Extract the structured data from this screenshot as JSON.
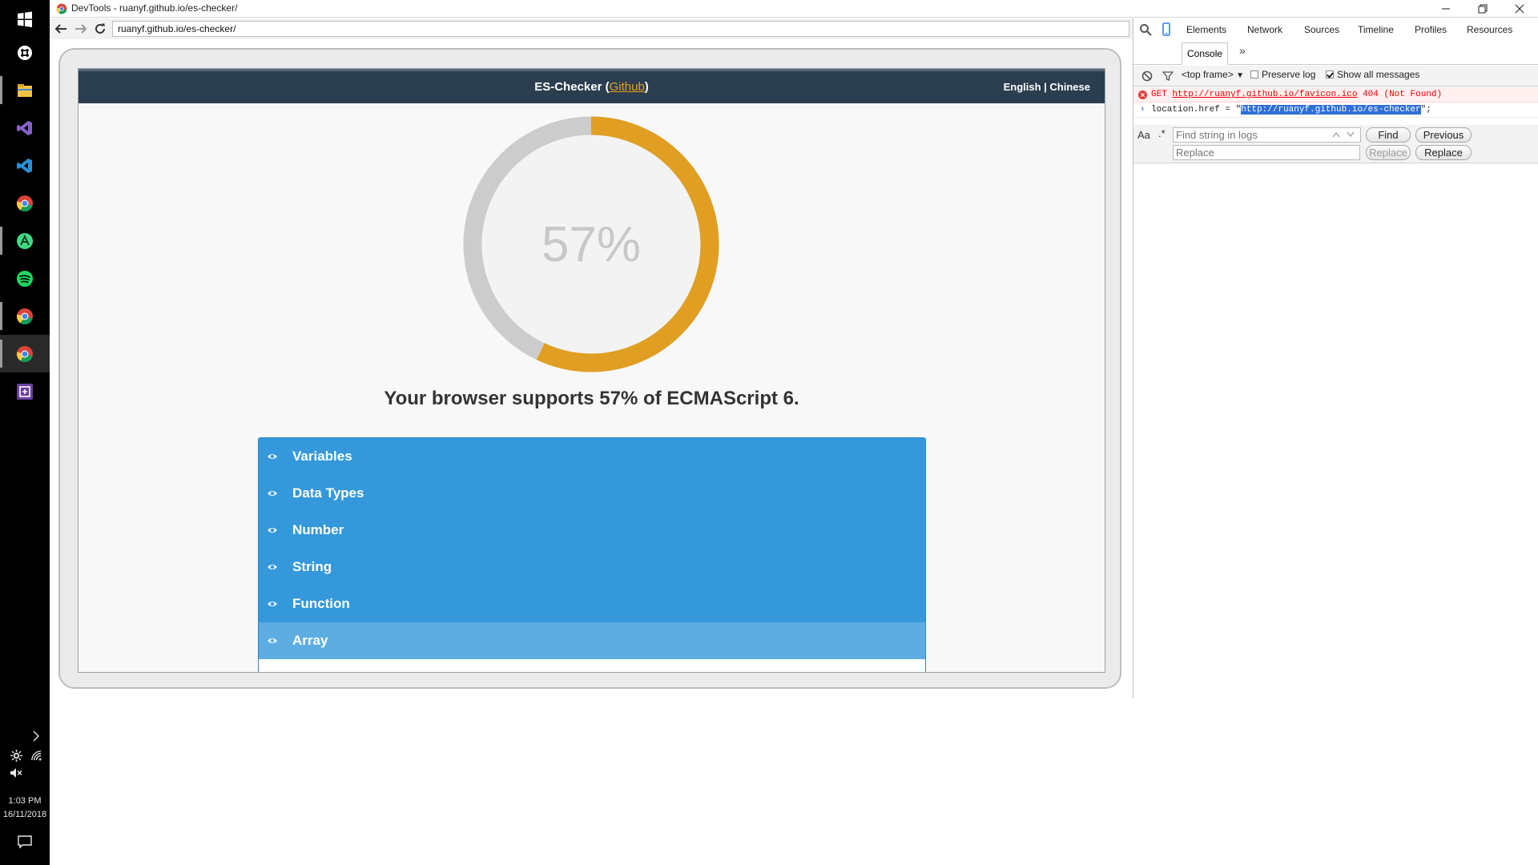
{
  "taskbar": {
    "apps": [
      {
        "name": "start",
        "icon": "windows-logo-icon"
      },
      {
        "name": "slack",
        "icon": "slack-icon"
      },
      {
        "name": "file-explorer",
        "icon": "folder-icon"
      },
      {
        "name": "visual-studio",
        "icon": "visual-studio-icon"
      },
      {
        "name": "vs-code",
        "icon": "vscode-icon"
      },
      {
        "name": "chrome-1",
        "icon": "chrome-icon"
      },
      {
        "name": "android-studio",
        "icon": "android-studio-icon"
      },
      {
        "name": "spotify",
        "icon": "spotify-icon"
      },
      {
        "name": "chrome-2",
        "icon": "chrome-icon"
      },
      {
        "name": "chrome-3",
        "icon": "chrome-icon"
      },
      {
        "name": "snipping",
        "icon": "app-icon"
      }
    ],
    "time": "1:03 PM",
    "date": "16/11/2018"
  },
  "browser": {
    "title": "DevTools - ruanyf.github.io/es-checker/",
    "url": "ruanyf.github.io/es-checker/"
  },
  "page": {
    "site_name": "ES-Checker",
    "github_label": "Github",
    "lang_english": "English",
    "lang_sep": "|",
    "lang_chinese": "Chinese",
    "score_label": "57%",
    "score_fraction": 0.57,
    "support_text": "Your browser supports 57% of ECMAScript 6.",
    "features": [
      "Variables",
      "Data Types",
      "Number",
      "String",
      "Function",
      "Array"
    ],
    "colors": {
      "accent": "#e09f22",
      "track": "#cccccc",
      "header": "#2b3e50",
      "list": "#3498db",
      "list_hover": "#5dade2"
    }
  },
  "devtools": {
    "tabs": [
      "Elements",
      "Network",
      "Sources",
      "Timeline",
      "Profiles",
      "Resources"
    ],
    "active_tab": "Console",
    "more": "»",
    "frame_select": "<top frame>",
    "preserve_log": "Preserve log",
    "show_all": "Show all messages",
    "error": {
      "method": "GET",
      "url": "http://ruanyf.github.io/favicon.ico",
      "status": "404 (Not Found)"
    },
    "command": {
      "prefix": "location.href = \"",
      "selected": "http://ruanyf.github.io/es-checker",
      "suffix": "\";"
    },
    "find": {
      "aa": "Aa",
      "regex": ".*",
      "find_placeholder": "Find string in logs",
      "replace_placeholder": "Replace",
      "find_btn": "Find",
      "previous_btn": "Previous",
      "replace_btn": "Replace",
      "replace_all_btn": "Replace"
    }
  }
}
